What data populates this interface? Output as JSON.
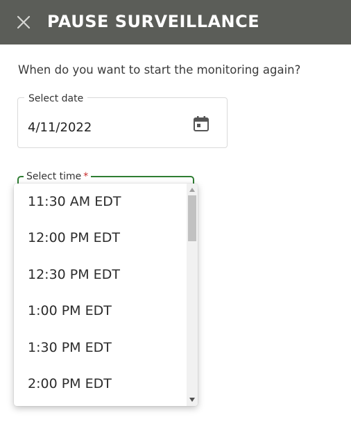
{
  "header": {
    "title": "PAUSE SURVEILLANCE",
    "close_icon": "close-icon"
  },
  "question": "When do you want to start the monitoring again?",
  "date_field": {
    "label": "Select date",
    "value": "4/11/2022",
    "icon": "calendar-icon"
  },
  "time_field": {
    "label": "Select time",
    "required_marker": "*"
  },
  "time_options": [
    "11:30 AM EDT",
    "12:00 PM EDT",
    "12:30 PM EDT",
    "1:00 PM EDT",
    "1:30 PM EDT",
    "2:00 PM EDT"
  ],
  "colors": {
    "header_bg": "#5b5d58",
    "focus_outline": "#2e7d32",
    "required": "#c62828"
  }
}
